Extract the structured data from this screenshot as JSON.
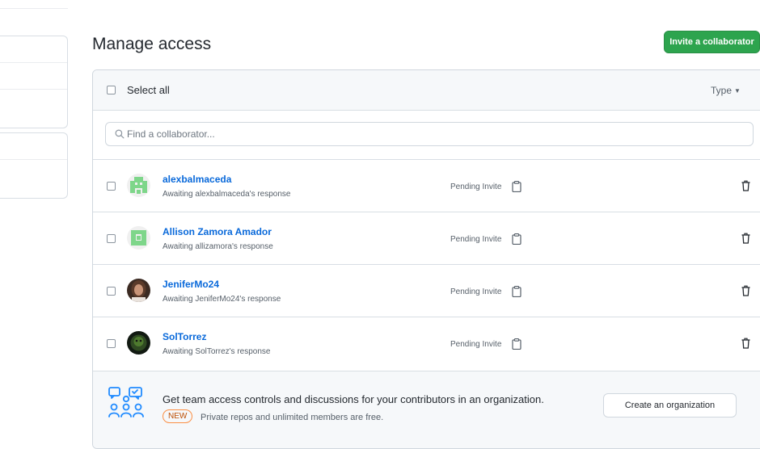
{
  "page": {
    "title": "Manage access",
    "invite_button": "Invite a collaborator"
  },
  "panel": {
    "select_all": "Select all",
    "type_filter": "Type",
    "search_placeholder": "Find a collaborator..."
  },
  "collaborators": [
    {
      "username": "alexbalmaceda",
      "subtitle": "Awaiting alexbalmaceda's response",
      "status": "Pending Invite",
      "avatar": "identicon-green"
    },
    {
      "username": "Allison Zamora Amador",
      "subtitle": "Awaiting allizamora's response",
      "status": "Pending Invite",
      "avatar": "identicon-green"
    },
    {
      "username": "JeniferMo24",
      "subtitle": "Awaiting JeniferMo24's response",
      "status": "Pending Invite",
      "avatar": "photo-portrait"
    },
    {
      "username": "SolTorrez",
      "subtitle": "Awaiting SolTorrez's response",
      "status": "Pending Invite",
      "avatar": "photo-dark"
    }
  ],
  "promo": {
    "text": "Get team access controls and discussions for your contributors in an organization.",
    "badge": "NEW",
    "subtext": "Private repos and unlimited members are free.",
    "button": "Create an organization"
  },
  "icons": {
    "search": "search-icon",
    "copy": "clipboard-icon",
    "delete": "trash-icon",
    "team": "people-discussion-icon",
    "caret": "caret-down-icon"
  },
  "colors": {
    "primary_green": "#2da44e",
    "link_blue": "#0969da",
    "new_badge": "#bc4c00",
    "identicon_green": "#7ed68a",
    "team_icon_blue": "#218bff"
  }
}
